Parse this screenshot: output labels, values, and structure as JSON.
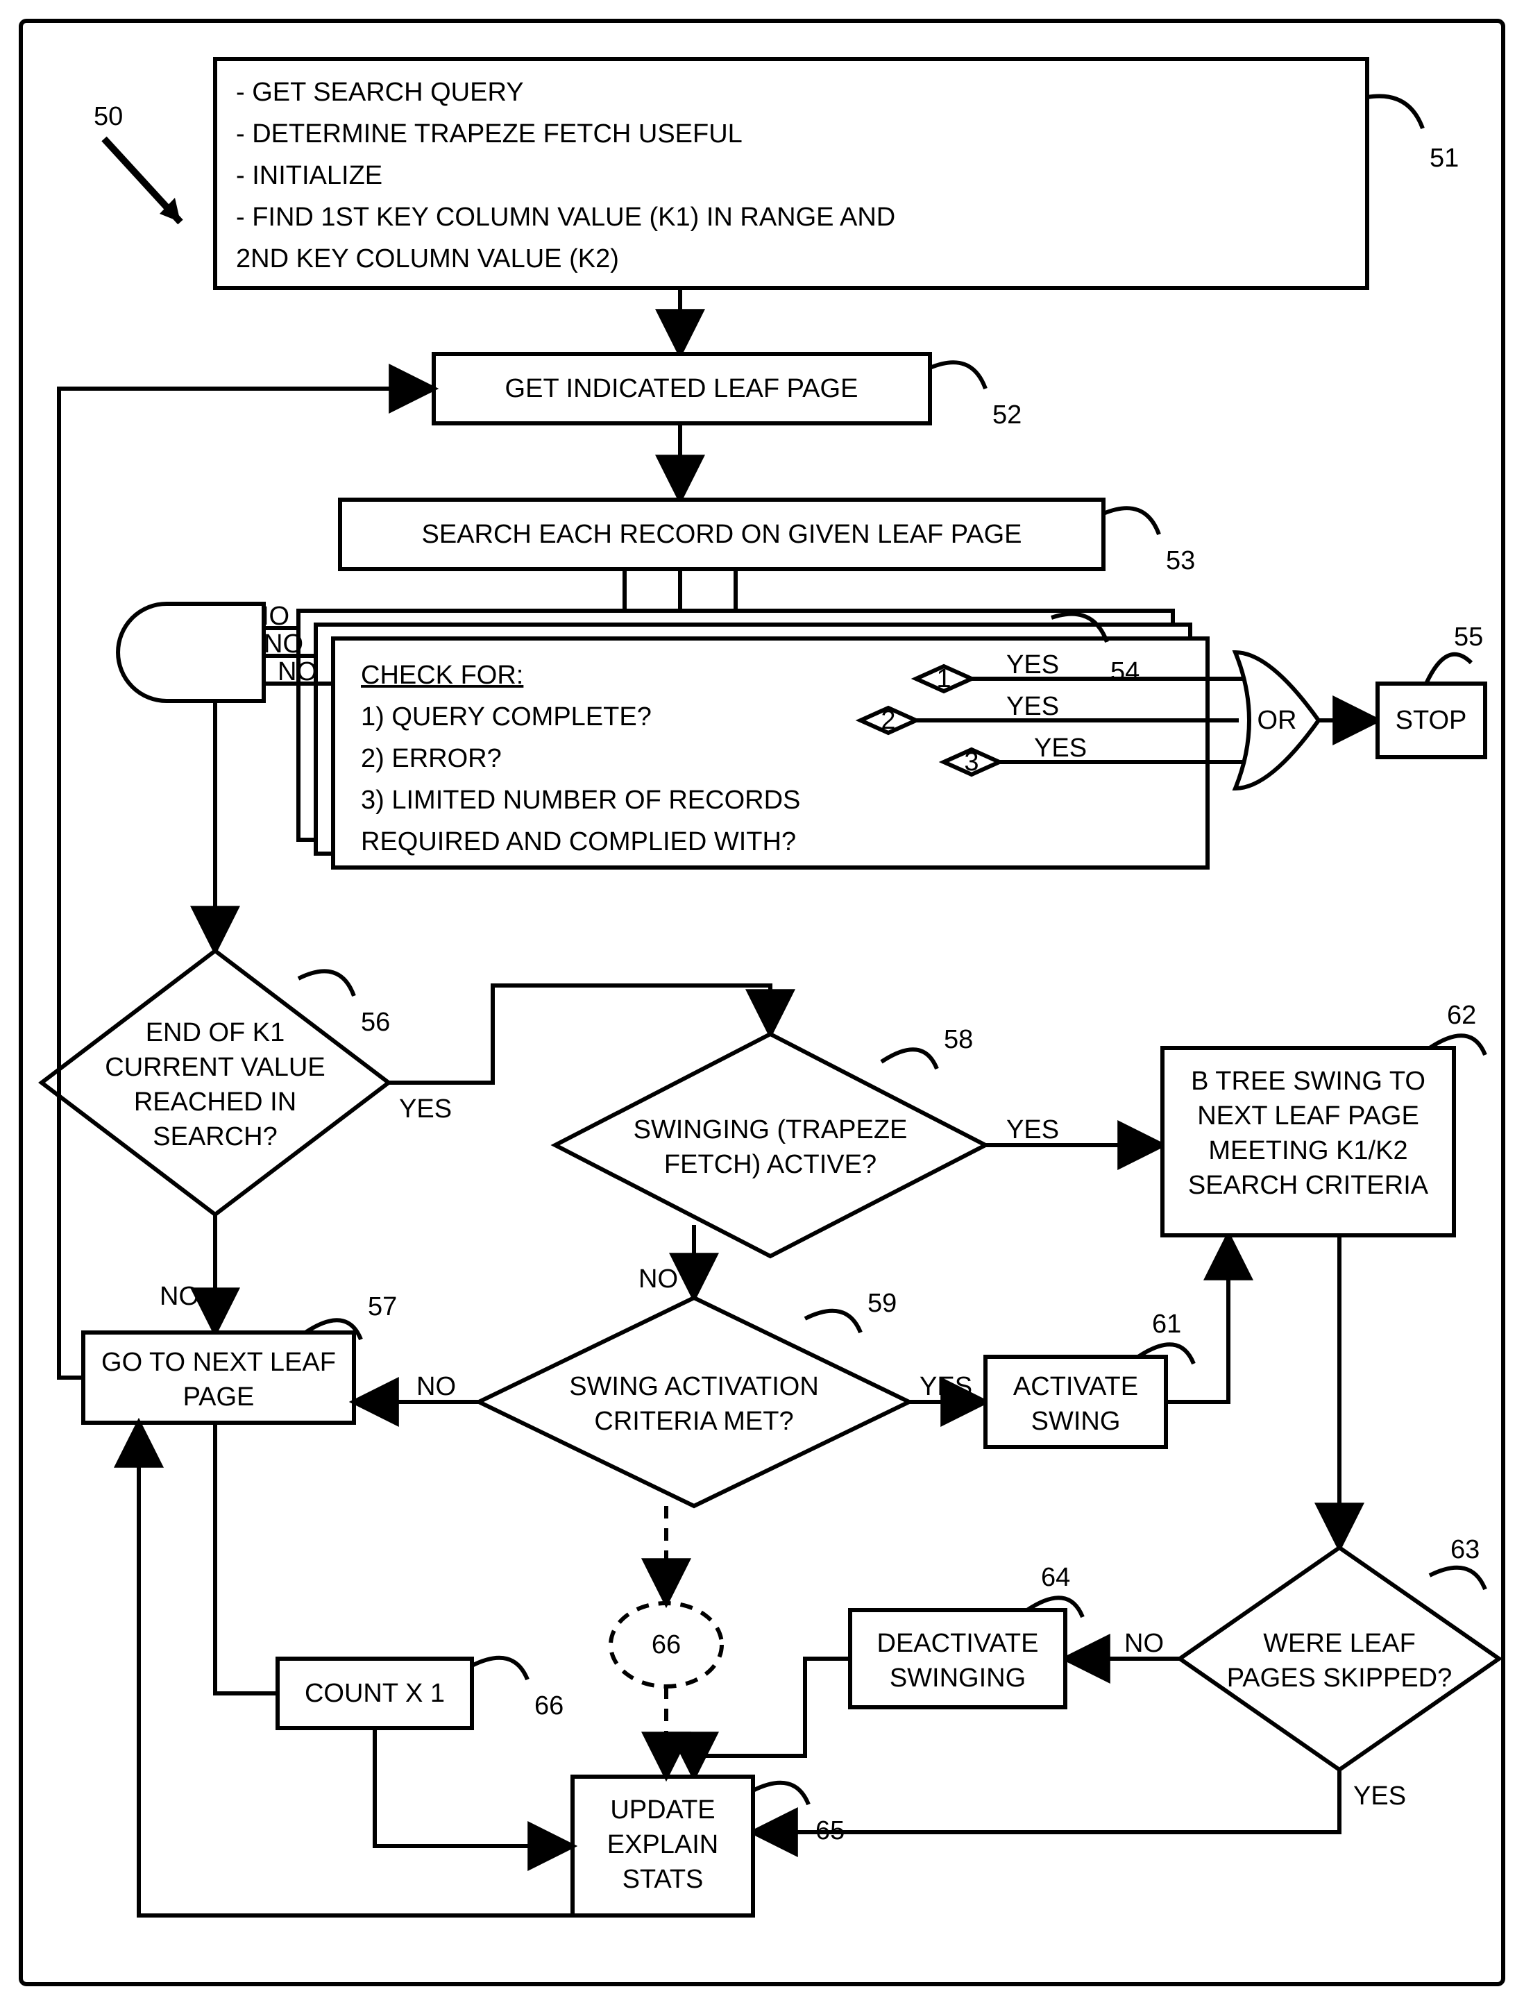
{
  "labels": {
    "ref50": "50",
    "ref51": "51",
    "ref52": "52",
    "ref53": "53",
    "ref54": "54",
    "ref55": "55",
    "ref56": "56",
    "ref57": "57",
    "ref58": "58",
    "ref59": "59",
    "ref61": "61",
    "ref62": "62",
    "ref63": "63",
    "ref64": "64",
    "ref65": "65",
    "ref66a": "66",
    "ref66b": "66"
  },
  "box51": {
    "l1": "- GET SEARCH QUERY",
    "l2": "- DETERMINE TRAPEZE FETCH USEFUL",
    "l3": "- INITIALIZE",
    "l4": "- FIND 1ST KEY COLUMN VALUE (K1) IN RANGE AND",
    "l5": "  2ND KEY COLUMN VALUE (K2)"
  },
  "box52": "GET INDICATED LEAF PAGE",
  "box53": "SEARCH EACH RECORD ON GIVEN LEAF PAGE",
  "box54": {
    "h": "CHECK FOR:",
    "l1": "1) QUERY COMPLETE?",
    "l2": "2) ERROR?",
    "l3": "3) LIMITED NUMBER OF RECORDS",
    "l4": "    REQUIRED AND COMPLIED WITH?"
  },
  "box55": "STOP",
  "or": "OR",
  "dec56": {
    "l1": "END OF K1",
    "l2": "CURRENT VALUE",
    "l3": "REACHED IN",
    "l4": "SEARCH?"
  },
  "box57": {
    "l1": "GO TO NEXT LEAF",
    "l2": "PAGE"
  },
  "dec58": {
    "l1": "SWINGING (TRAPEZE",
    "l2": "FETCH) ACTIVE?"
  },
  "dec59": {
    "l1": "SWING ACTIVATION",
    "l2": "CRITERIA MET?"
  },
  "box61": {
    "l1": "ACTIVATE",
    "l2": "SWING"
  },
  "box62": {
    "l1": "B TREE SWING TO",
    "l2": "NEXT LEAF PAGE",
    "l3": "MEETING K1/K2",
    "l4": "SEARCH CRITERIA"
  },
  "dec63": {
    "l1": "WERE LEAF",
    "l2": "PAGES SKIPPED?"
  },
  "box64": {
    "l1": "DEACTIVATE",
    "l2": "SWINGING"
  },
  "box65": {
    "l1": "UPDATE",
    "l2": "EXPLAIN",
    "l3": "STATS"
  },
  "box66": "COUNT X 1",
  "yn": {
    "yes": "YES",
    "no": "NO",
    "d1": "1",
    "d2": "2",
    "d3": "3"
  }
}
